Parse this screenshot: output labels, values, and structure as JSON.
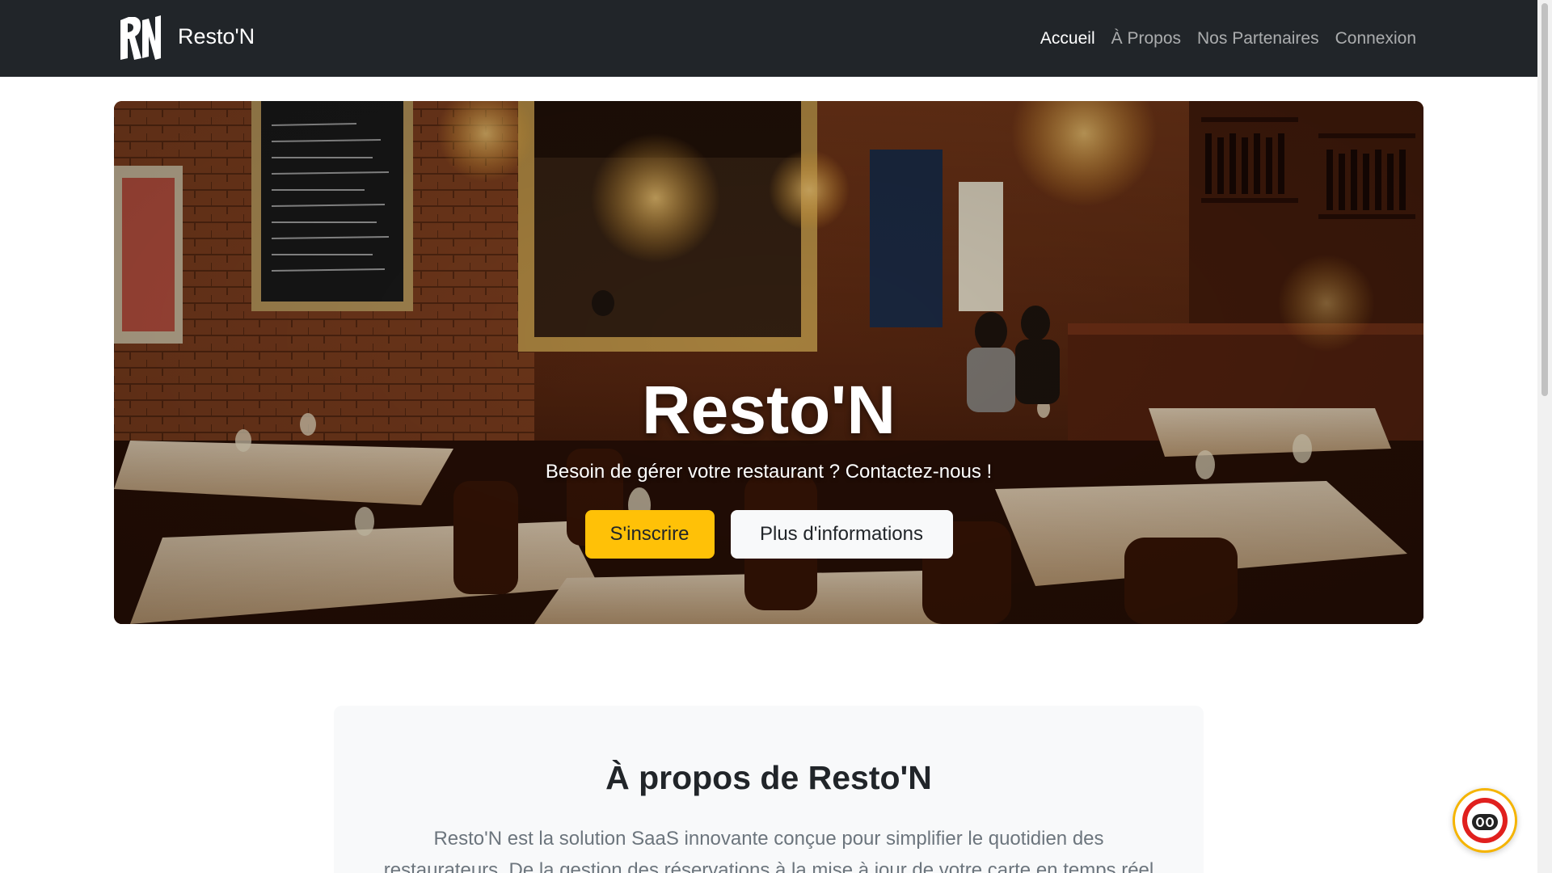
{
  "navbar": {
    "brand_logo_text": "RN",
    "brand_name": "Resto'N",
    "links": [
      {
        "label": "Accueil",
        "active": true
      },
      {
        "label": "À Propos",
        "active": false
      },
      {
        "label": "Nos Partenaires",
        "active": false
      },
      {
        "label": "Connexion",
        "active": false
      }
    ]
  },
  "hero": {
    "title": "Resto'N",
    "subtitle": "Besoin de gérer votre restaurant ? Contactez-nous !",
    "primary_button": "S'inscrire",
    "secondary_button": "Plus d'informations"
  },
  "about": {
    "title": "À propos de Resto'N",
    "text": "Resto'N est la solution SaaS innovante conçue pour simplifier le quotidien des restaurateurs. De la gestion des réservations à la mise à jour de votre carte en temps réel"
  },
  "colors": {
    "navbar_bg": "#212529",
    "accent": "#ffc107",
    "light_button": "#f8f9fa",
    "about_bg": "#f8f9fa",
    "muted_text": "#6c757d"
  },
  "icons": {
    "chat_widget": "chat-bot-icon",
    "brand": "rn-logo-icon"
  }
}
